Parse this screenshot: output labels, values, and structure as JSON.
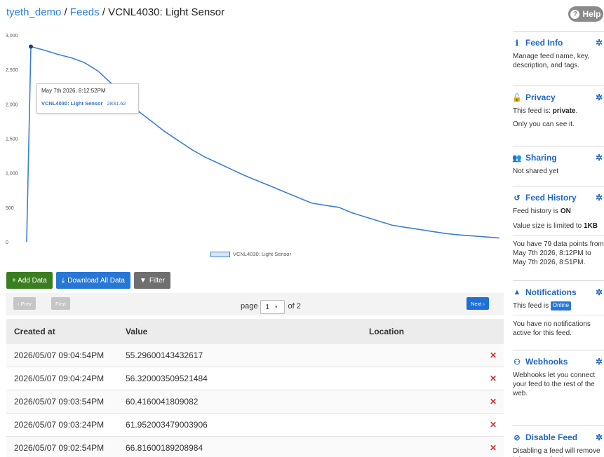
{
  "breadcrumb": {
    "user": "tyeth_demo",
    "sep1": " / ",
    "feeds": "Feeds",
    "sep2": " / ",
    "title": "VCNL4030: Light Sensor"
  },
  "help": {
    "label": "Help",
    "icon": "?"
  },
  "tooltip": {
    "date": "May 7th 2026, 8:12:52PM",
    "series": "VCNL4030: Light Sensor",
    "value": "2831.62"
  },
  "legend": {
    "label": "VCNL4030: Light Sensor"
  },
  "chart_data": {
    "type": "line",
    "series": [
      {
        "name": "VCNL4030: Light Sensor",
        "x_index": [
          0,
          1,
          2,
          3,
          4,
          5,
          6,
          7,
          8,
          9,
          10,
          11,
          12,
          13,
          14,
          15,
          16,
          17,
          18,
          19,
          20,
          21,
          22,
          23,
          24,
          25,
          26,
          27,
          28,
          29,
          30,
          31,
          32,
          33,
          34,
          35,
          36
        ],
        "values": [
          0,
          2832,
          2780,
          2720,
          2670,
          2600,
          2480,
          2300,
          2050,
          1900,
          1750,
          1600,
          1470,
          1340,
          1230,
          1140,
          1050,
          960,
          880,
          800,
          720,
          640,
          560,
          530,
          500,
          420,
          360,
          300,
          240,
          210,
          180,
          150,
          120,
          100,
          85,
          70,
          55
        ]
      }
    ],
    "ytick_labels": [
      "0",
      "500",
      "1,000",
      "1,500",
      "2,000",
      "2,500",
      "3,000"
    ],
    "ylim": [
      0,
      3000
    ],
    "grid": false,
    "legend_position": "bottom-center"
  },
  "actions": {
    "add": "+ Add Data",
    "download": "Download All Data",
    "filter": "Filter"
  },
  "pager": {
    "prev": "‹ Prev",
    "first": "First",
    "page_label": "page",
    "page_value": "1",
    "of_label": "of 2",
    "next": "Next ›"
  },
  "table": {
    "headers": {
      "created": "Created at",
      "value": "Value",
      "location": "Location"
    },
    "rows": [
      {
        "created": "2026/05/07 09:04:54PM",
        "value": "55.29600143432617"
      },
      {
        "created": "2026/05/07 09:04:24PM",
        "value": "56.320003509521484"
      },
      {
        "created": "2026/05/07 09:03:54PM",
        "value": "60.4160041809082"
      },
      {
        "created": "2026/05/07 09:03:24PM",
        "value": "61.952003479003906"
      },
      {
        "created": "2026/05/07 09:02:54PM",
        "value": "66.81600189208984"
      }
    ],
    "delete_symbol": "✕"
  },
  "sidebar": {
    "feed_info": {
      "title": "Feed Info",
      "text": "Manage feed name, key, description, and tags."
    },
    "privacy": {
      "title": "Privacy",
      "text1_prefix": "This feed is: ",
      "text1_bold": "private",
      "text1_suffix": ".",
      "text2": "Only you can see it."
    },
    "sharing": {
      "title": "Sharing",
      "text": "Not shared yet"
    },
    "history": {
      "title": "Feed History",
      "text1_prefix": "Feed history is ",
      "text1_bold": "ON",
      "text2_prefix": "Value size is limited to ",
      "text2_bold": "1KB",
      "text3": "You have 79 data points from May 7th 2026, 8:12PM to May 7th 2026, 8:51PM."
    },
    "notifications": {
      "title": "Notifications",
      "text1_prefix": "This feed is ",
      "badge": "Online",
      "text2": "You have no notifications active for this feed."
    },
    "webhooks": {
      "title": "Webhooks",
      "text": "Webhooks let you connect your feed to the rest of the web."
    },
    "disable": {
      "title": "Disable Feed",
      "text": "Disabling a feed will remove it from your feed"
    }
  },
  "colors": {
    "accent": "#1f66c9",
    "line": "#3a7fd4",
    "green": "#3a7f1f",
    "delete": "#d32f2f"
  }
}
